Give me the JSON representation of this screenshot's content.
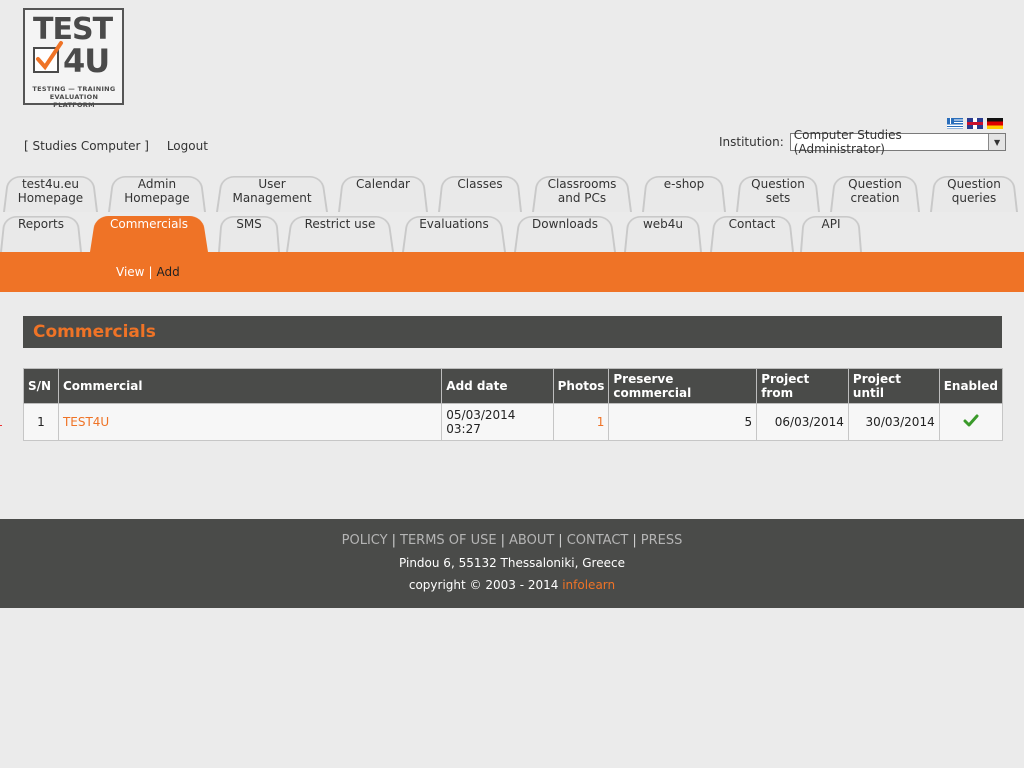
{
  "logo": {
    "line1": "TEST",
    "line2": "4U",
    "sub": "TESTING — TRAINING EVALUATION PLATFORM"
  },
  "flags": [
    "greek-flag-icon",
    "uk-flag-icon",
    "german-flag-icon"
  ],
  "user": {
    "name": "[ Studies Computer ]",
    "logout": "Logout"
  },
  "institution": {
    "label": "Institution:",
    "value": "Computer Studies (Administrator)"
  },
  "tabs_row1": [
    {
      "l1": "test4u.eu",
      "l2": "Homepage"
    },
    {
      "l1": "Admin",
      "l2": "Homepage"
    },
    {
      "l1": "User",
      "l2": "Management"
    },
    {
      "l1": "Calendar",
      "l2": ""
    },
    {
      "l1": "Classes",
      "l2": ""
    },
    {
      "l1": "Classrooms",
      "l2": "and PCs"
    },
    {
      "l1": "e-shop",
      "l2": ""
    },
    {
      "l1": "Question",
      "l2": "sets"
    },
    {
      "l1": "Question",
      "l2": "creation"
    },
    {
      "l1": "Question",
      "l2": "queries"
    }
  ],
  "tabs_row2": [
    {
      "l1": "Reports"
    },
    {
      "l1": "Commercials"
    },
    {
      "l1": "SMS"
    },
    {
      "l1": "Restrict use"
    },
    {
      "l1": "Evaluations"
    },
    {
      "l1": "Downloads"
    },
    {
      "l1": "web4u"
    },
    {
      "l1": "Contact"
    },
    {
      "l1": "API"
    }
  ],
  "subnav": {
    "view": "View",
    "sep": "|",
    "add": "Add"
  },
  "panel": {
    "title": "Commercials"
  },
  "table": {
    "headers": [
      "S/N",
      "Commercial",
      "Add date",
      "Photos",
      "Preserve commercial",
      "Project from",
      "Project until",
      "Enabled"
    ],
    "rows": [
      {
        "sn": "1",
        "commercial": "TEST4U",
        "add_date": "05/03/2014 03:27",
        "photos": "1",
        "preserve": "5",
        "from": "06/03/2014",
        "until": "30/03/2014",
        "enabled": "check-icon"
      }
    ]
  },
  "footer": {
    "links": [
      "POLICY",
      "TERMS OF USE",
      "ABOUT",
      "CONTACT",
      "PRESS"
    ],
    "sep": "|",
    "address": "Pindou 6, 55132 Thessaloniki, Greece",
    "copyright": "copyright © 2003 - 2014",
    "company": "infolearn"
  },
  "colors": {
    "accent": "#ef7326",
    "dark": "#4a4b49",
    "background": "#ebebeb"
  }
}
